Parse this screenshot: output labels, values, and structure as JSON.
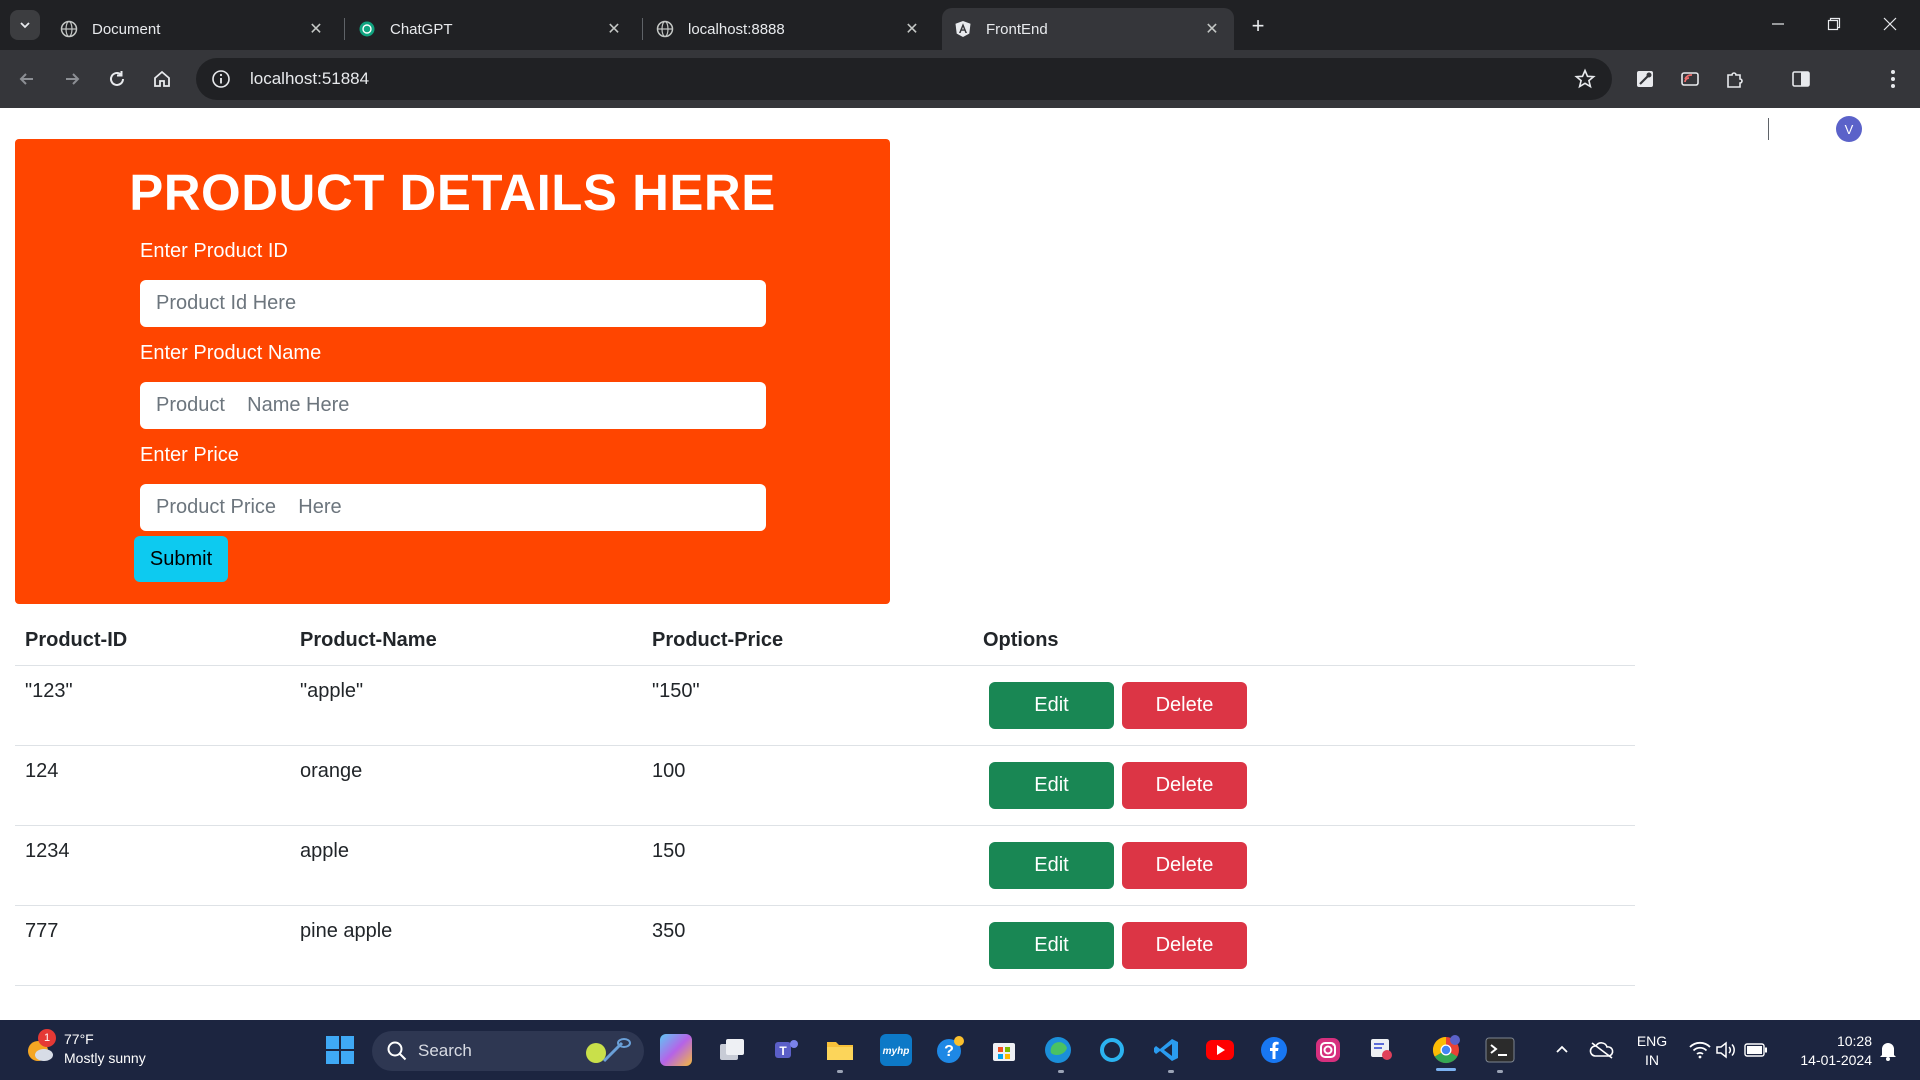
{
  "browser": {
    "tabs": [
      {
        "title": "Document",
        "icon": "globe-icon",
        "active": false
      },
      {
        "title": "ChatGPT",
        "icon": "chatgpt-icon",
        "active": false
      },
      {
        "title": "localhost:8888",
        "icon": "globe-icon",
        "active": false
      },
      {
        "title": "FrontEnd",
        "icon": "angular-icon",
        "active": true
      }
    ],
    "url": "localhost:51884",
    "profile_initial": "V"
  },
  "form": {
    "title": "PRODUCT DETAILS HERE",
    "id_label": "Enter Product ID",
    "id_placeholder": "Product Id Here",
    "name_label": "Enter Product Name",
    "name_placeholder": "Product    Name Here",
    "price_label": "Enter Price",
    "price_placeholder": "Product Price    Here",
    "submit_label": "Submit"
  },
  "table": {
    "headers": [
      "Product-ID",
      "Product-Name",
      "Product-Price",
      "Options"
    ],
    "rows": [
      {
        "id": "\"123\"",
        "name": "\"apple\"",
        "price": "\"150\""
      },
      {
        "id": "124",
        "name": "orange",
        "price": "100"
      },
      {
        "id": "1234",
        "name": "apple",
        "price": "150"
      },
      {
        "id": "777",
        "name": "pine apple",
        "price": "350"
      }
    ],
    "edit_label": "Edit",
    "delete_label": "Delete"
  },
  "taskbar": {
    "weather_temp": "77°F",
    "weather_desc": "Mostly sunny",
    "weather_badge": "1",
    "search_label": "Search",
    "lang_line1": "ENG",
    "lang_line2": "IN",
    "time": "10:28",
    "date": "14-01-2024"
  },
  "colors": {
    "form_bg": "#ff4500",
    "submit": "#0dcaf0",
    "edit": "#198754",
    "delete": "#dc3545"
  }
}
